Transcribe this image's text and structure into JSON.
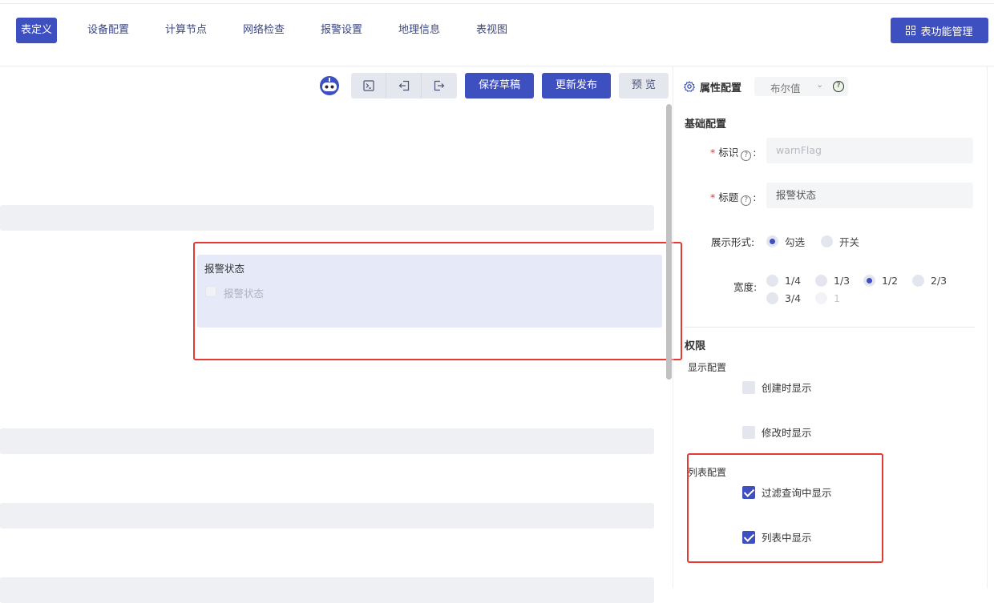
{
  "nav": {
    "tabs": [
      {
        "label": "表定义",
        "active": true
      },
      {
        "label": "设备配置"
      },
      {
        "label": "计算节点"
      },
      {
        "label": "网络检查"
      },
      {
        "label": "报警设置"
      },
      {
        "label": "地理信息"
      },
      {
        "label": "表视图"
      }
    ],
    "func_button": "表功能管理"
  },
  "toolbar": {
    "save_draft": "保存草稿",
    "publish": "更新发布",
    "preview": "预 览",
    "icons": [
      "terminal-icon",
      "import-icon",
      "export-icon"
    ]
  },
  "canvas": {
    "field_title": "报警状态",
    "field_checkbox_label": "报警状态"
  },
  "panel": {
    "title": "属性配置",
    "type_value": "布尔值",
    "basic_title": "基础配置",
    "id_label": "标识",
    "id_value": "warnFlag",
    "title_label": "标题",
    "title_value": "报警状态",
    "display_label": "展示形式:",
    "display_options": [
      "勾选",
      "开关"
    ],
    "display_selected": "勾选",
    "width_label": "宽度:",
    "width_options": [
      "1/4",
      "1/3",
      "1/2",
      "2/3",
      "3/4",
      "1"
    ],
    "width_selected": "1/2",
    "perm_title": "权限",
    "show_config": "显示配置",
    "show_on_create": "创建时显示",
    "show_on_edit": "修改时显示",
    "list_config": "列表配置",
    "show_in_filter": "过滤查询中显示",
    "show_in_list": "列表中显示"
  },
  "colors": {
    "primary": "#3e4fbf",
    "highlight": "#e53935",
    "selected_card": "#e5e9f8"
  }
}
